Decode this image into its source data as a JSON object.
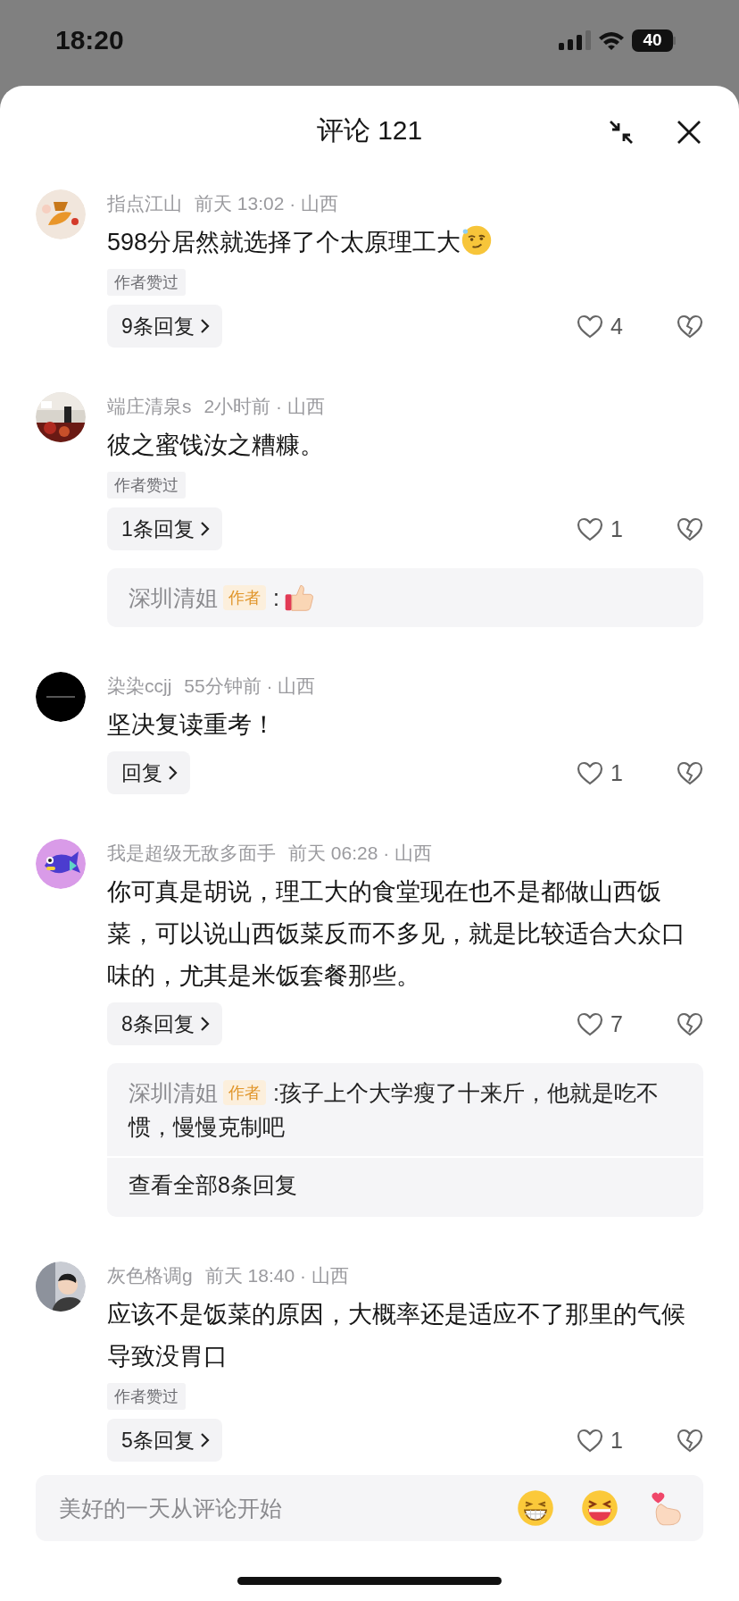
{
  "status_bar": {
    "time": "18:20",
    "battery": "40"
  },
  "header": {
    "title": "评论 121"
  },
  "comments": [
    {
      "author": "指点江山",
      "time_location": "前天 13:02 · 山西",
      "text": "598分居然就选择了个太原理工大",
      "text_icon": {
        "kind": "smirk"
      },
      "tag": "作者赞过",
      "replies_button": "9条回复",
      "liked": false,
      "like_count": "4"
    },
    {
      "author": "端庄清泉s",
      "time_location": "2小时前 · 山西",
      "text": "彼之蜜饯汝之糟糠。",
      "tag": "作者赞过",
      "replies_button": "1条回复",
      "liked": false,
      "like_count": "1",
      "replies": [
        {
          "author": "深圳清姐",
          "badge": "作者",
          "text": ":",
          "text_icon": {
            "kind": "thumbs_up"
          }
        }
      ]
    },
    {
      "author": "染染ccjj",
      "time_location": "55分钟前 · 山西",
      "text": "坚决复读重考！",
      "replies_button": "回复",
      "liked": false,
      "like_count": "1"
    },
    {
      "author": "我是超级无敌多面手",
      "time_location": "前天 06:28 · 山西",
      "text": "你可真是胡说，理工大的食堂现在也不是都做山西饭菜，可以说山西饭菜反而不多见，就是比较适合大众口味的，尤其是米饭套餐那些。",
      "replies_button": "8条回复",
      "liked": false,
      "like_count": "7",
      "replies": [
        {
          "author": "深圳清姐",
          "badge": "作者",
          "text": ":孩子上个大学瘦了十来斤，他就是吃不惯，慢慢克制吧"
        }
      ],
      "view_all": "查看全部8条回复"
    },
    {
      "author": "灰色格调g",
      "time_location": "前天 18:40 · 山西",
      "text": "应该不是饭菜的原因，大概率还是适应不了那里的气候导致没胃口",
      "tag": "作者赞过",
      "replies_button": "5条回复",
      "liked": false,
      "like_count": "1"
    }
  ],
  "input": {
    "placeholder": "美好的一天从评论开始",
    "emoji_buttons": [
      {
        "kind": "grin"
      },
      {
        "kind": "laugh"
      },
      {
        "kind": "finger_heart"
      }
    ]
  }
}
